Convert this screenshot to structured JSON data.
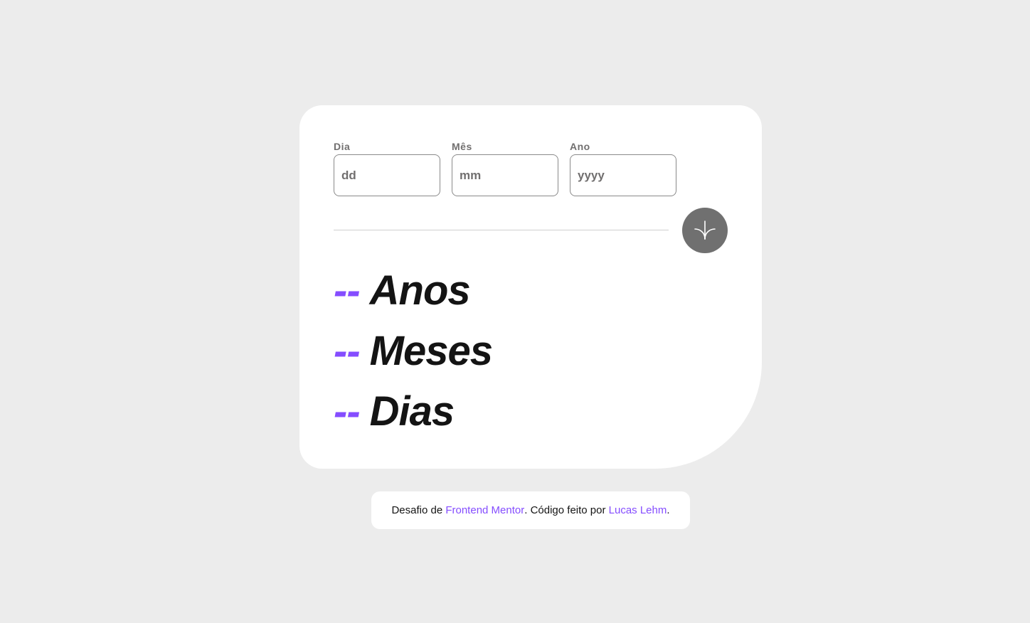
{
  "form": {
    "day": {
      "label": "Dia",
      "placeholder": "dd",
      "value": ""
    },
    "month": {
      "label": "Mês",
      "placeholder": "mm",
      "value": ""
    },
    "year": {
      "label": "Ano",
      "placeholder": "yyyy",
      "value": ""
    }
  },
  "submit_icon": "arrow-down-icon",
  "results": [
    {
      "value": "--",
      "unit": "Anos"
    },
    {
      "value": "--",
      "unit": "Meses"
    },
    {
      "value": "--",
      "unit": "Dias"
    }
  ],
  "footer": {
    "prefix": "Desafio de ",
    "link1": "Frontend Mentor",
    "middle": ". Código feito por ",
    "link2": "Lucas Lehm",
    "suffix": "."
  },
  "colors": {
    "accent": "#854dff",
    "background": "#ececec",
    "button": "#707070",
    "result_text": "#141414"
  }
}
